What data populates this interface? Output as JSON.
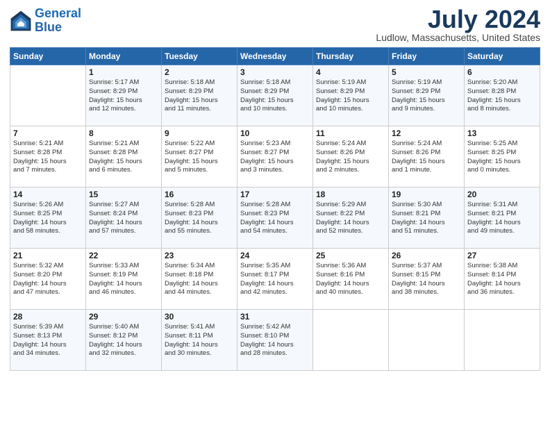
{
  "header": {
    "logo_line1": "General",
    "logo_line2": "Blue",
    "month": "July 2024",
    "location": "Ludlow, Massachusetts, United States"
  },
  "weekdays": [
    "Sunday",
    "Monday",
    "Tuesday",
    "Wednesday",
    "Thursday",
    "Friday",
    "Saturday"
  ],
  "weeks": [
    [
      {
        "day": "",
        "info": ""
      },
      {
        "day": "1",
        "info": "Sunrise: 5:17 AM\nSunset: 8:29 PM\nDaylight: 15 hours\nand 12 minutes."
      },
      {
        "day": "2",
        "info": "Sunrise: 5:18 AM\nSunset: 8:29 PM\nDaylight: 15 hours\nand 11 minutes."
      },
      {
        "day": "3",
        "info": "Sunrise: 5:18 AM\nSunset: 8:29 PM\nDaylight: 15 hours\nand 10 minutes."
      },
      {
        "day": "4",
        "info": "Sunrise: 5:19 AM\nSunset: 8:29 PM\nDaylight: 15 hours\nand 10 minutes."
      },
      {
        "day": "5",
        "info": "Sunrise: 5:19 AM\nSunset: 8:29 PM\nDaylight: 15 hours\nand 9 minutes."
      },
      {
        "day": "6",
        "info": "Sunrise: 5:20 AM\nSunset: 8:28 PM\nDaylight: 15 hours\nand 8 minutes."
      }
    ],
    [
      {
        "day": "7",
        "info": "Sunrise: 5:21 AM\nSunset: 8:28 PM\nDaylight: 15 hours\nand 7 minutes."
      },
      {
        "day": "8",
        "info": "Sunrise: 5:21 AM\nSunset: 8:28 PM\nDaylight: 15 hours\nand 6 minutes."
      },
      {
        "day": "9",
        "info": "Sunrise: 5:22 AM\nSunset: 8:27 PM\nDaylight: 15 hours\nand 5 minutes."
      },
      {
        "day": "10",
        "info": "Sunrise: 5:23 AM\nSunset: 8:27 PM\nDaylight: 15 hours\nand 3 minutes."
      },
      {
        "day": "11",
        "info": "Sunrise: 5:24 AM\nSunset: 8:26 PM\nDaylight: 15 hours\nand 2 minutes."
      },
      {
        "day": "12",
        "info": "Sunrise: 5:24 AM\nSunset: 8:26 PM\nDaylight: 15 hours\nand 1 minute."
      },
      {
        "day": "13",
        "info": "Sunrise: 5:25 AM\nSunset: 8:25 PM\nDaylight: 15 hours\nand 0 minutes."
      }
    ],
    [
      {
        "day": "14",
        "info": "Sunrise: 5:26 AM\nSunset: 8:25 PM\nDaylight: 14 hours\nand 58 minutes."
      },
      {
        "day": "15",
        "info": "Sunrise: 5:27 AM\nSunset: 8:24 PM\nDaylight: 14 hours\nand 57 minutes."
      },
      {
        "day": "16",
        "info": "Sunrise: 5:28 AM\nSunset: 8:23 PM\nDaylight: 14 hours\nand 55 minutes."
      },
      {
        "day": "17",
        "info": "Sunrise: 5:28 AM\nSunset: 8:23 PM\nDaylight: 14 hours\nand 54 minutes."
      },
      {
        "day": "18",
        "info": "Sunrise: 5:29 AM\nSunset: 8:22 PM\nDaylight: 14 hours\nand 52 minutes."
      },
      {
        "day": "19",
        "info": "Sunrise: 5:30 AM\nSunset: 8:21 PM\nDaylight: 14 hours\nand 51 minutes."
      },
      {
        "day": "20",
        "info": "Sunrise: 5:31 AM\nSunset: 8:21 PM\nDaylight: 14 hours\nand 49 minutes."
      }
    ],
    [
      {
        "day": "21",
        "info": "Sunrise: 5:32 AM\nSunset: 8:20 PM\nDaylight: 14 hours\nand 47 minutes."
      },
      {
        "day": "22",
        "info": "Sunrise: 5:33 AM\nSunset: 8:19 PM\nDaylight: 14 hours\nand 46 minutes."
      },
      {
        "day": "23",
        "info": "Sunrise: 5:34 AM\nSunset: 8:18 PM\nDaylight: 14 hours\nand 44 minutes."
      },
      {
        "day": "24",
        "info": "Sunrise: 5:35 AM\nSunset: 8:17 PM\nDaylight: 14 hours\nand 42 minutes."
      },
      {
        "day": "25",
        "info": "Sunrise: 5:36 AM\nSunset: 8:16 PM\nDaylight: 14 hours\nand 40 minutes."
      },
      {
        "day": "26",
        "info": "Sunrise: 5:37 AM\nSunset: 8:15 PM\nDaylight: 14 hours\nand 38 minutes."
      },
      {
        "day": "27",
        "info": "Sunrise: 5:38 AM\nSunset: 8:14 PM\nDaylight: 14 hours\nand 36 minutes."
      }
    ],
    [
      {
        "day": "28",
        "info": "Sunrise: 5:39 AM\nSunset: 8:13 PM\nDaylight: 14 hours\nand 34 minutes."
      },
      {
        "day": "29",
        "info": "Sunrise: 5:40 AM\nSunset: 8:12 PM\nDaylight: 14 hours\nand 32 minutes."
      },
      {
        "day": "30",
        "info": "Sunrise: 5:41 AM\nSunset: 8:11 PM\nDaylight: 14 hours\nand 30 minutes."
      },
      {
        "day": "31",
        "info": "Sunrise: 5:42 AM\nSunset: 8:10 PM\nDaylight: 14 hours\nand 28 minutes."
      },
      {
        "day": "",
        "info": ""
      },
      {
        "day": "",
        "info": ""
      },
      {
        "day": "",
        "info": ""
      }
    ]
  ]
}
